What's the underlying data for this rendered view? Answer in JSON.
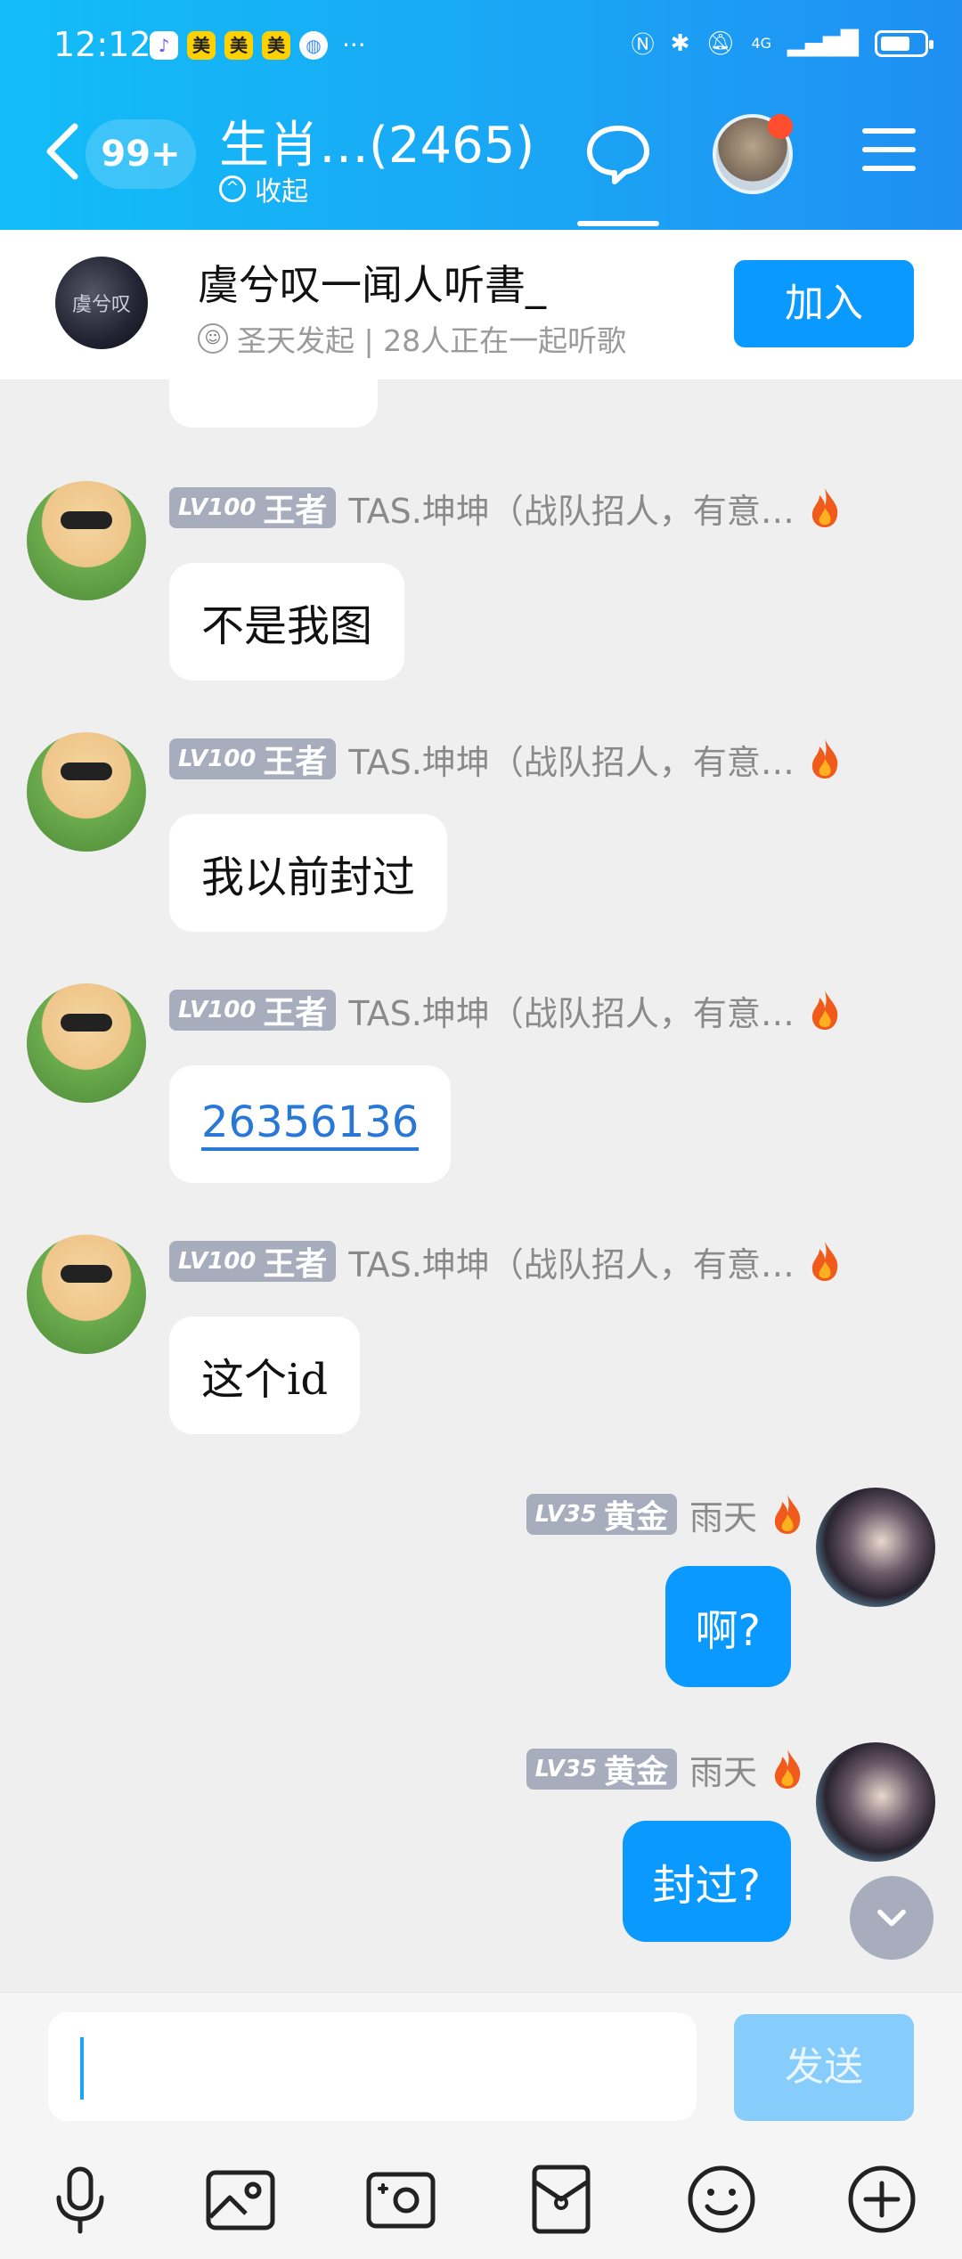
{
  "status_bar": {
    "time": "12:12",
    "app_icons": [
      "music-app-icon",
      "美",
      "美",
      "美",
      "globe-app-icon"
    ],
    "more": "···",
    "network": "4G"
  },
  "header": {
    "unread_count": "99+",
    "group_title": "生肖…(2465)",
    "collapse_label": "收起"
  },
  "listen_banner": {
    "title": "虞兮叹一闻人听書_",
    "subtitle": "圣天发起 | 28人正在一起听歌",
    "join_label": "加入",
    "cover_text": "虞兮叹"
  },
  "messages": [
    {
      "sender": "TAS.坤坤（战队招人，有意…",
      "lv": "LV100",
      "rank": "王者",
      "text": "不是我图"
    },
    {
      "sender": "TAS.坤坤（战队招人，有意…",
      "lv": "LV100",
      "rank": "王者",
      "text": "我以前封过"
    },
    {
      "sender": "TAS.坤坤（战队招人，有意…",
      "lv": "LV100",
      "rank": "王者",
      "text": "26356136"
    },
    {
      "sender": "TAS.坤坤（战队招人，有意…",
      "lv": "LV100",
      "rank": "王者",
      "text": "这个id"
    },
    {
      "sender": "雨天",
      "lv": "LV35",
      "rank": "黄金",
      "text": "啊?"
    },
    {
      "sender": "雨天",
      "lv": "LV35",
      "rank": "黄金",
      "text": "封过?"
    }
  ],
  "input": {
    "value": "",
    "send_label": "发送"
  },
  "colors": {
    "header_start": "#12bdf7",
    "header_end": "#1f8ff3",
    "accent": "#0a99ff",
    "badge": "#a8adbd"
  }
}
